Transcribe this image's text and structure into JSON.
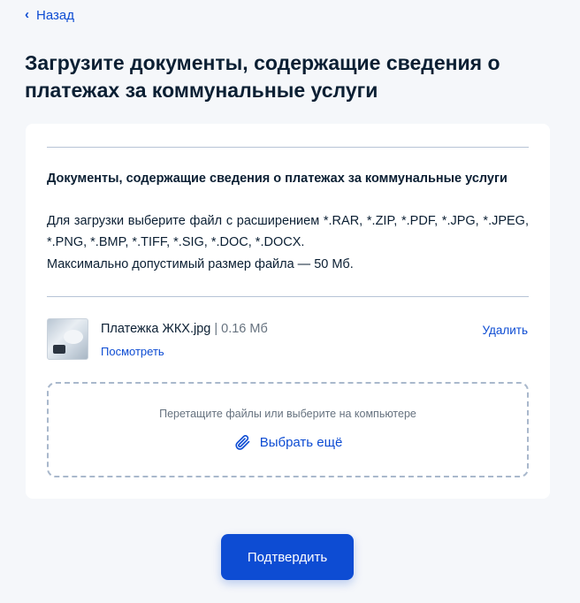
{
  "nav": {
    "back_label": "Назад"
  },
  "page": {
    "title": "Загрузите документы, содержащие сведения о платежах за коммунальные услуги"
  },
  "document": {
    "heading": "Документы, содержащие сведения о платежах за коммунальные услуги",
    "description": "Для загрузки выберите файл с расширением *.RAR, *.ZIP, *.PDF, *.JPG, *.JPEG, *.PNG, *.BMP, *.TIFF, *.SIG, *.DOC, *.DOCX.",
    "size_limit": "Максимально допустимый размер файла — 50 Мб."
  },
  "uploaded_file": {
    "name": "Платежка ЖКХ.jpg",
    "separator": "|",
    "size": "0.16 Мб",
    "view_label": "Посмотреть",
    "delete_label": "Удалить"
  },
  "dropzone": {
    "hint": "Перетащите файлы или выберите на компьютере",
    "select_more_label": "Выбрать ещё"
  },
  "actions": {
    "confirm_label": "Подтвердить"
  },
  "colors": {
    "accent": "#0d4cd3",
    "text": "#0b1f33",
    "muted": "#66727f",
    "background": "#f5f7fa"
  },
  "icons": {
    "back": "chevron-left-icon",
    "attach": "paperclip-icon"
  }
}
